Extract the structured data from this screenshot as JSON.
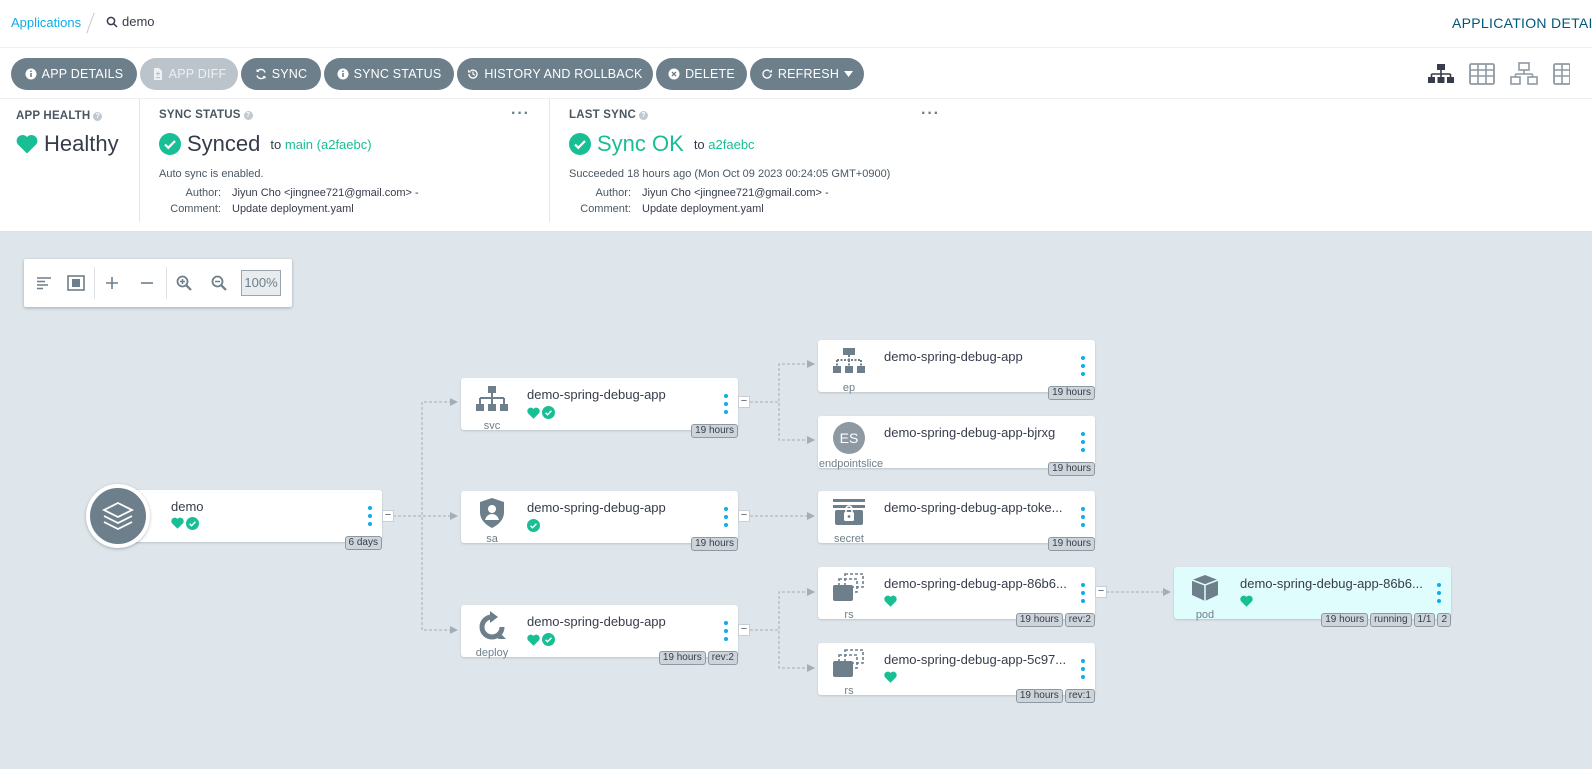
{
  "breadcrumb": {
    "applications": "Applications",
    "current": "demo"
  },
  "header": {
    "title": "APPLICATION DETAILS TREE"
  },
  "toolbar": {
    "app_details": "APP DETAILS",
    "app_diff": "APP DIFF",
    "sync": "SYNC",
    "sync_status": "SYNC STATUS",
    "history": "HISTORY AND ROLLBACK",
    "delete": "DELETE",
    "refresh": "REFRESH"
  },
  "app_health": {
    "label": "APP HEALTH",
    "value": "Healthy"
  },
  "sync_status": {
    "label": "SYNC STATUS",
    "value": "Synced",
    "to": "to",
    "revision": "main (a2faebc)",
    "auto_sync": "Auto sync is enabled.",
    "author_label": "Author:",
    "author": "Jiyun Cho <jingnee721@gmail.com> -",
    "comment_label": "Comment:",
    "comment": "Update deployment.yaml"
  },
  "last_sync": {
    "label": "LAST SYNC",
    "value": "Sync OK",
    "to": "to",
    "revision": "a2faebc",
    "succeeded": "Succeeded 18 hours ago (Mon Oct 09 2023 00:24:05 GMT+0900)",
    "author_label": "Author:",
    "author": "Jiyun Cho <jingnee721@gmail.com> -",
    "comment_label": "Comment:",
    "comment": "Update deployment.yaml"
  },
  "zoom": {
    "level": "100%"
  },
  "graph": {
    "root": {
      "name": "demo",
      "age": "6 days"
    },
    "nodes": {
      "svc": {
        "kind": "svc",
        "name": "demo-spring-debug-app",
        "age": "19 hours"
      },
      "sa": {
        "kind": "sa",
        "name": "demo-spring-debug-app",
        "age": "19 hours"
      },
      "deploy": {
        "kind": "deploy",
        "name": "demo-spring-debug-app",
        "age": "19 hours",
        "rev": "rev:2"
      },
      "ep": {
        "kind": "ep",
        "name": "demo-spring-debug-app",
        "age": "19 hours"
      },
      "es": {
        "kind": "endpointslice",
        "icon_text": "ES",
        "name": "demo-spring-debug-app-bjrxg",
        "age": "19 hours"
      },
      "secret": {
        "kind": "secret",
        "name": "demo-spring-debug-app-toke...",
        "age": "19 hours"
      },
      "rs1": {
        "kind": "rs",
        "name": "demo-spring-debug-app-86b6...",
        "age": "19 hours",
        "rev": "rev:2"
      },
      "rs2": {
        "kind": "rs",
        "name": "demo-spring-debug-app-5c97...",
        "age": "19 hours",
        "rev": "rev:1"
      },
      "pod": {
        "kind": "pod",
        "name": "demo-spring-debug-app-86b6...",
        "age": "19 hours",
        "status": "running",
        "ready": "1/1",
        "count": "2"
      }
    }
  },
  "colors": {
    "accent": "#0dadea",
    "healthy": "#18be94",
    "button": "#6d7f8b",
    "graph_bg": "#dee6eb"
  }
}
